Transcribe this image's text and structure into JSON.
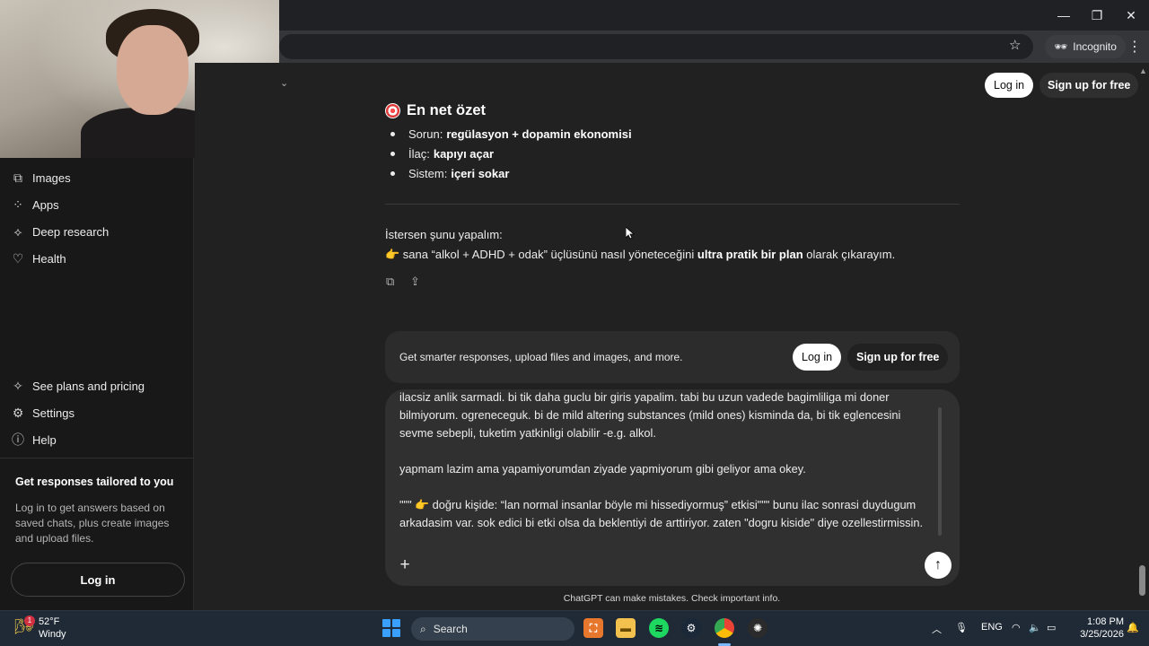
{
  "browser": {
    "incognito_label": "Incognito",
    "window_controls": {
      "minimize": "—",
      "restore": "❐",
      "close": "✕"
    }
  },
  "sidebar": {
    "items": [
      {
        "label": "Images",
        "icon": "images-icon"
      },
      {
        "label": "Apps",
        "icon": "apps-icon"
      },
      {
        "label": "Deep research",
        "icon": "deep-research-icon"
      },
      {
        "label": "Health",
        "icon": "heart-icon"
      }
    ],
    "bottom_items": [
      {
        "label": "See plans and pricing",
        "icon": "plans-icon"
      },
      {
        "label": "Settings",
        "icon": "gear-icon"
      },
      {
        "label": "Help",
        "icon": "help-icon"
      }
    ],
    "promo": {
      "title": "Get responses tailored to you",
      "text": "Log in to get answers based on saved chats, plus create images and upload files.",
      "login_label": "Log in"
    }
  },
  "header": {
    "login_label": "Log in",
    "signup_label": "Sign up for free"
  },
  "conversation": {
    "summary_title": "En net özet",
    "bullets": [
      {
        "label": "Sorun:",
        "value": "regülasyon + dopamin ekonomisi"
      },
      {
        "label": "İlaç:",
        "value": "kapıyı açar"
      },
      {
        "label": "Sistem:",
        "value": "içeri sokar"
      }
    ],
    "offer_line1": "İstersen şunu yapalım:",
    "offer_line2_prefix": "👉 sana “alkol + ADHD + odak” üçlüsünü nasıl yöneteceğini",
    "offer_line2_bold": "ultra pratik bir plan",
    "offer_line2_suffix": "olarak çıkarayım."
  },
  "smart_bar": {
    "text": "Get smarter responses, upload files and images, and more.",
    "login_label": "Log in",
    "signup_label": "Sign up for free"
  },
  "composer": {
    "text": "ilacsiz anlik sarmadi. bi tik daha guclu bir giris yapalim. tabi bu uzun vadede bagimliliga mi doner bilmiyorum. ogreneceguk. bi de mild altering substances (mild ones) kisminda da, bi tik eglencesini sevme sebepli, tuketim yatkinligi olabilir -e.g. alkol.\n\nyapmam lazim ama yapamiyorumdan ziyade yapmiyorum gibi geliyor ama okey.\n\n\"\"\" 👉 doğru kişide: “lan normal insanlar böyle mi hissediyormuş” etkisi\"\"\" bunu ilac sonrasi duydugum arkadasim var. sok edici bi etki olsa da beklentiyi de arttiriyor. zaten \"dogru kiside\" diye ozellestirmissin."
  },
  "disclaimer": "ChatGPT can make mistakes. Check important info.",
  "taskbar": {
    "weather_badge": "1",
    "temperature": "52°F",
    "condition": "Windy",
    "search_label": "Search",
    "language": "ENG",
    "time": "1:08 PM",
    "date": "3/25/2026"
  }
}
